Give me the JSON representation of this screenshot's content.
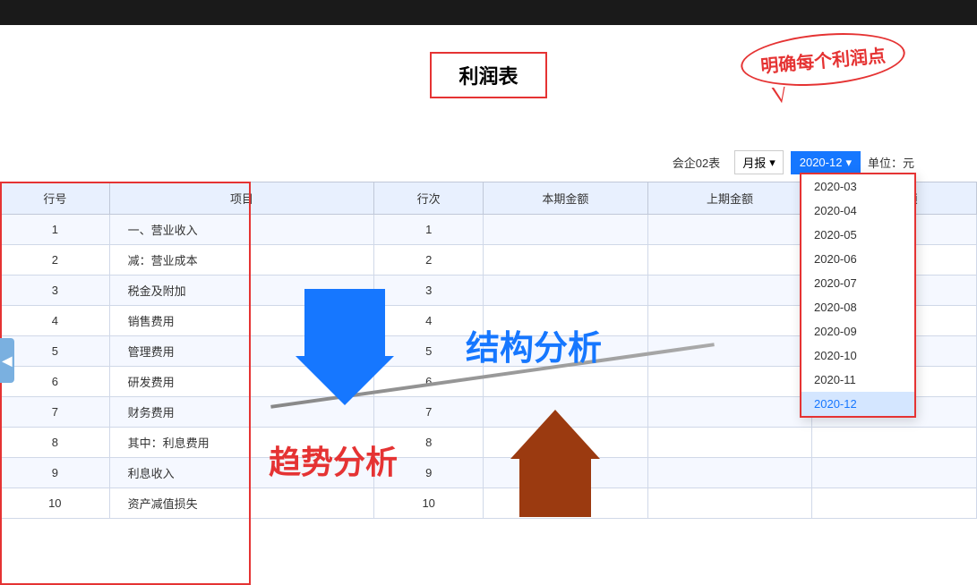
{
  "topBar": {},
  "speechBubble": {
    "text": "明确每个利润点"
  },
  "title": {
    "text": "利润表"
  },
  "controls": {
    "companyLabel": "会企02表",
    "periodType": "月报",
    "periodValue": "2020-12",
    "unitLabel": "单位：元"
  },
  "dropdownOptions": [
    "2020-03",
    "2020-04",
    "2020-05",
    "2020-06",
    "2020-07",
    "2020-08",
    "2020-09",
    "2020-10",
    "2020-11",
    "2020-12"
  ],
  "selectedOption": "2020-12",
  "tableHeaders": [
    "行号",
    "项目",
    "行次",
    "本期金额",
    "上期金额",
    "本年金额"
  ],
  "tableRows": [
    {
      "id": 1,
      "item": "一、营业收入",
      "seq": 1,
      "current": "",
      "prev": "",
      "annual": ""
    },
    {
      "id": 2,
      "item": "减：营业成本",
      "seq": 2,
      "current": "",
      "prev": "",
      "annual": ""
    },
    {
      "id": 3,
      "item": "税金及附加",
      "seq": 3,
      "current": "",
      "prev": "",
      "annual": ""
    },
    {
      "id": 4,
      "item": "销售费用",
      "seq": 4,
      "current": "",
      "prev": "",
      "annual": ""
    },
    {
      "id": 5,
      "item": "管理费用",
      "seq": 5,
      "current": "",
      "prev": "",
      "annual": ""
    },
    {
      "id": 6,
      "item": "研发费用",
      "seq": 6,
      "current": "",
      "prev": "",
      "annual": ""
    },
    {
      "id": 7,
      "item": "财务费用",
      "seq": 7,
      "current": "",
      "prev": "",
      "annual": ""
    },
    {
      "id": 8,
      "item": "其中：利息费用",
      "seq": 8,
      "current": "",
      "prev": "",
      "annual": ""
    },
    {
      "id": 9,
      "item": "利息收入",
      "seq": 9,
      "current": "",
      "prev": "",
      "annual": ""
    },
    {
      "id": 10,
      "item": "资产减值损失",
      "seq": 10,
      "current": "",
      "prev": "",
      "annual": ""
    }
  ],
  "overlayTexts": {
    "jiegou": "结构分析",
    "qushi": "趋势分析"
  },
  "leftBtn": "◀"
}
